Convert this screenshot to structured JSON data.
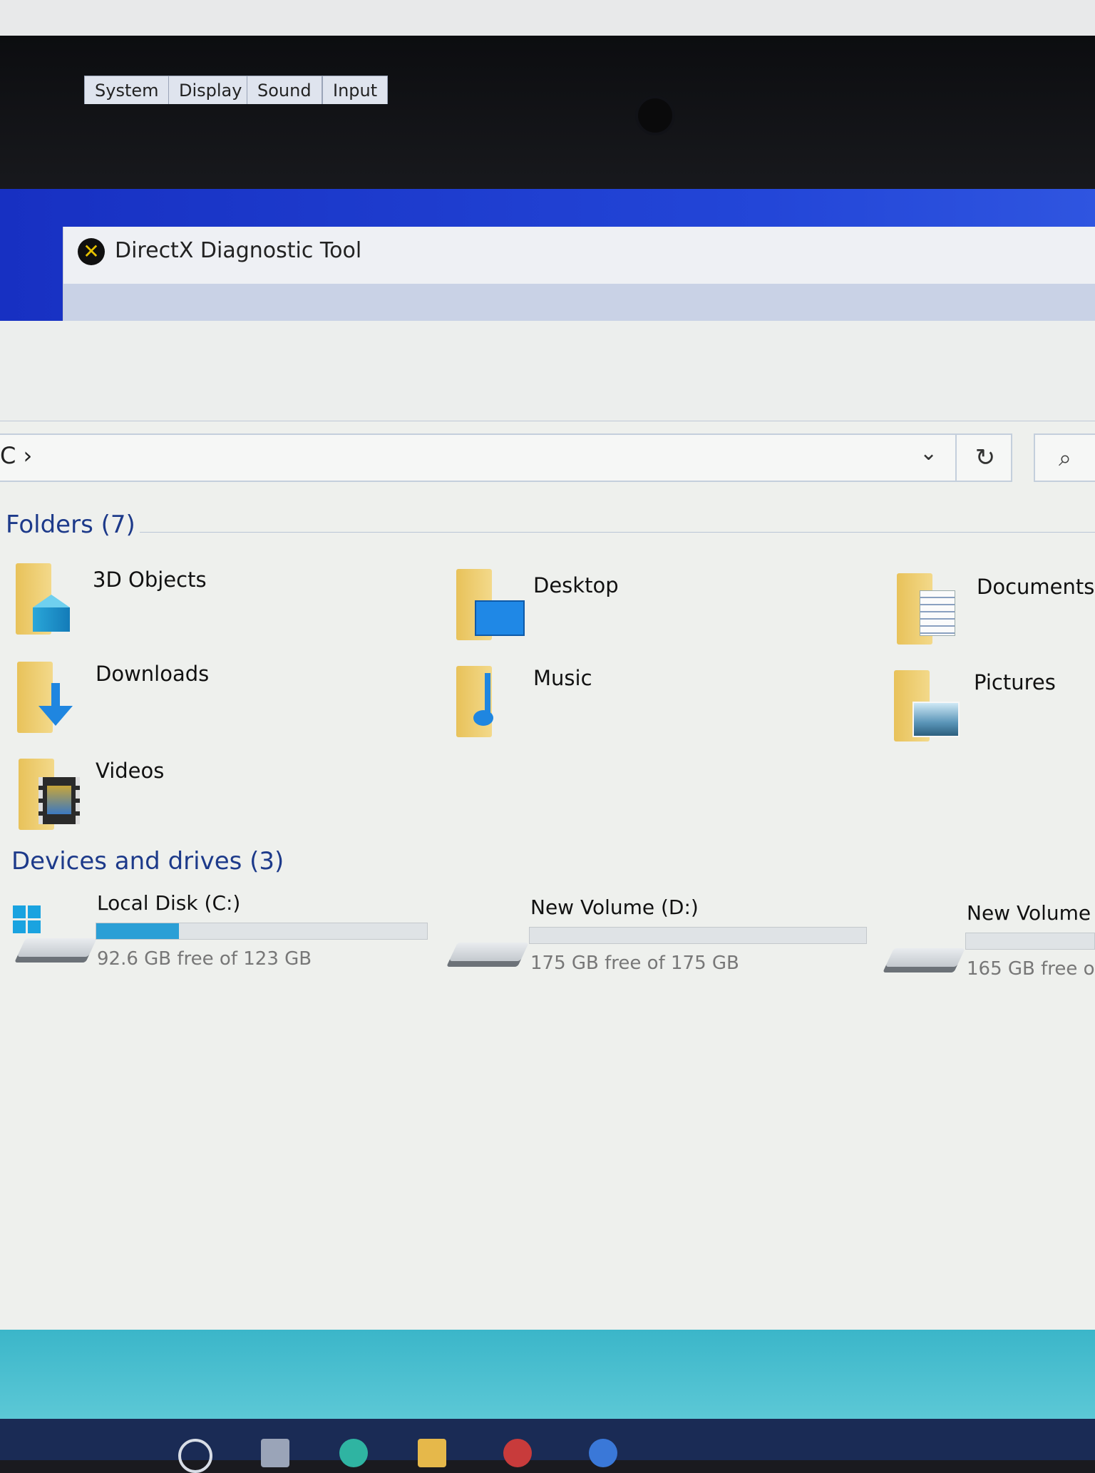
{
  "directx": {
    "title": "DirectX Diagnostic Tool",
    "logo_glyph": "✕",
    "tabs": [
      "System",
      "Display",
      "Sound",
      "Input"
    ]
  },
  "explorer": {
    "address_text": "C  ›",
    "address_chevron": "⌄",
    "refresh_glyph": "↻",
    "search_glyph": "⌕",
    "folders_header": "Folders (7)",
    "folders": [
      {
        "label": "3D Objects",
        "icon": "3d-objects-icon"
      },
      {
        "label": "Desktop",
        "icon": "desktop-folder-icon"
      },
      {
        "label": "Documents",
        "icon": "documents-folder-icon"
      },
      {
        "label": "Downloads",
        "icon": "downloads-folder-icon"
      },
      {
        "label": "Music",
        "icon": "music-folder-icon"
      },
      {
        "label": "Pictures",
        "icon": "pictures-folder-icon"
      },
      {
        "label": "Videos",
        "icon": "videos-folder-icon"
      }
    ],
    "drives_header": "Devices and drives (3)",
    "drives": [
      {
        "name": "Local Disk (C:)",
        "free": "92.6 GB free of 123 GB",
        "used_fraction": 0.25
      },
      {
        "name": "New Volume (D:)",
        "free": "175 GB free of 175 GB",
        "used_fraction": 0.0
      },
      {
        "name": "New Volume (",
        "free": "165 GB free of",
        "used_fraction": 0.0
      }
    ]
  },
  "colors": {
    "accent": "#2b9fd6",
    "header": "#1d3a8a",
    "desktop": "#2346d8",
    "folder": "#f0d27a"
  }
}
